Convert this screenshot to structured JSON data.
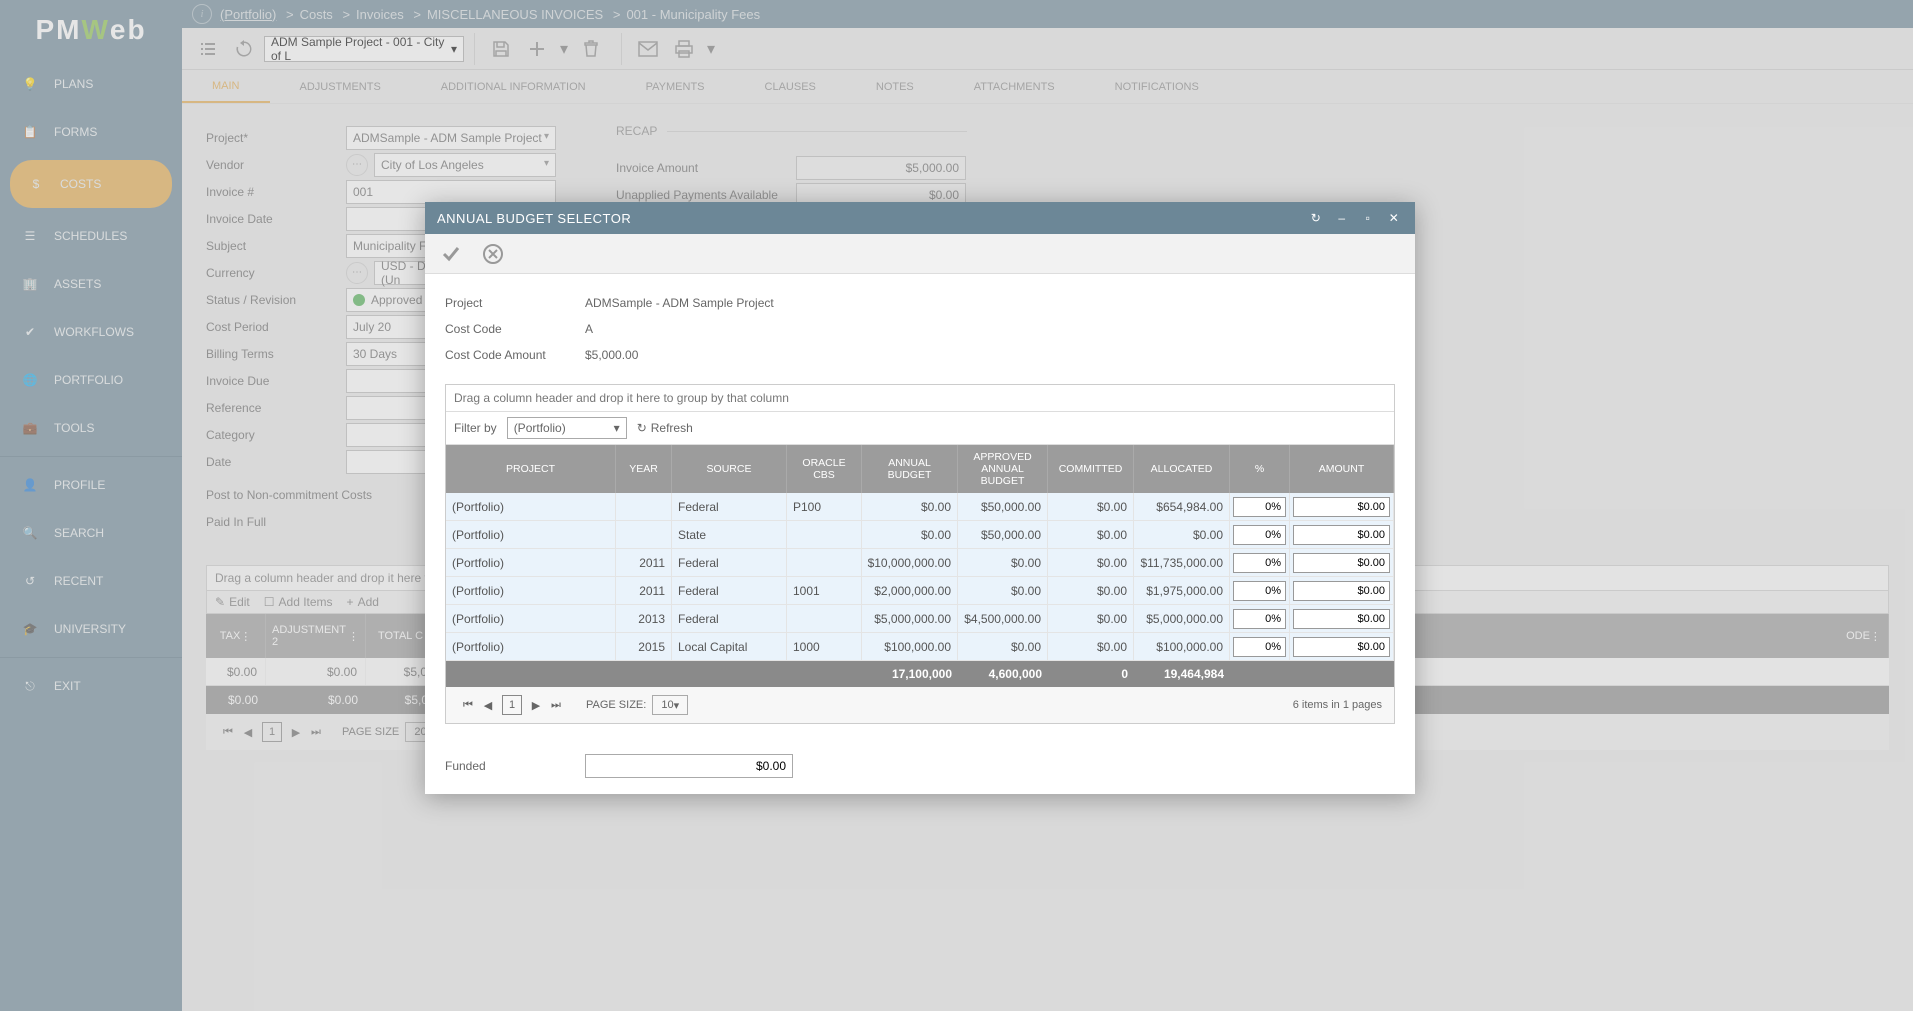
{
  "logo": {
    "p": "PM",
    "w": "W",
    "eb": "eb"
  },
  "breadcrumb": {
    "portfolio": "(Portfolio)",
    "c1": "Costs",
    "c2": "Invoices",
    "c3": "MISCELLANEOUS INVOICES",
    "c4": "001 - Municipality Fees"
  },
  "sidebar": {
    "plans": "PLANS",
    "forms": "FORMS",
    "costs": "COSTS",
    "schedules": "SCHEDULES",
    "assets": "ASSETS",
    "workflows": "WORKFLOWS",
    "portfolio": "PORTFOLIO",
    "tools": "TOOLS",
    "profile": "PROFILE",
    "search": "SEARCH",
    "recent": "RECENT",
    "university": "UNIVERSITY",
    "exit": "EXIT"
  },
  "toolbar": {
    "project": "ADM Sample Project - 001 - City of L"
  },
  "tabs": {
    "main": "MAIN",
    "adjustments": "ADJUSTMENTS",
    "additional": "ADDITIONAL INFORMATION",
    "payments": "PAYMENTS",
    "clauses": "CLAUSES",
    "notes": "NOTES",
    "attachments": "ATTACHMENTS",
    "notifications": "NOTIFICATIONS"
  },
  "form": {
    "labels": {
      "project": "Project*",
      "vendor": "Vendor",
      "invoice_no": "Invoice #",
      "invoice_date": "Invoice Date",
      "subject": "Subject",
      "currency": "Currency",
      "status": "Status / Revision",
      "cost_period": "Cost Period",
      "billing_terms": "Billing Terms",
      "invoice_due": "Invoice Due",
      "reference": "Reference",
      "category": "Category",
      "date": "Date",
      "post_noncommit": "Post to Non-commitment Costs",
      "paid_full": "Paid In Full"
    },
    "values": {
      "project": "ADMSample - ADM Sample Project",
      "vendor": "City of Los Angeles",
      "invoice_no": "001",
      "subject": "Municipality Fee",
      "currency": "USD - Dollar (Un",
      "status": "Approved",
      "cost_period": "July 20",
      "billing_terms": "30 Days"
    },
    "recap": {
      "title": "RECAP",
      "invoice_amount_lbl": "Invoice Amount",
      "invoice_amount": "$5,000.00",
      "unapplied_lbl": "Unapplied Payments Available",
      "unapplied": "$0.00"
    }
  },
  "bottom_grid": {
    "group_hint": "Drag a column header and drop it here to g",
    "edit": "Edit",
    "add_items": "Add Items",
    "add": "Add",
    "headers": {
      "tax": "TAX",
      "adj2": "ADJUSTMENT 2",
      "totalc": "TOTAL C",
      "ode": "ODE"
    },
    "row": {
      "v1": "$0.00",
      "v2": "$0.00",
      "v3": "$5,0"
    },
    "totals": {
      "v1": "$0.00",
      "v2": "$0.00",
      "v3": "$5,0"
    },
    "page_size_lbl": "PAGE SIZE",
    "page_size": "20",
    "page": "1"
  },
  "modal": {
    "title": "ANNUAL BUDGET SELECTOR",
    "info": {
      "project_lbl": "Project",
      "project": "ADMSample - ADM Sample Project",
      "costcode_lbl": "Cost Code",
      "costcode": "A",
      "amount_lbl": "Cost Code Amount",
      "amount": "$5,000.00"
    },
    "grid": {
      "group_hint": "Drag a column header and drop it here to group by that column",
      "filter_by": "Filter by",
      "filter_value": "(Portfolio)",
      "refresh": "Refresh",
      "headers": {
        "project": "PROJECT",
        "year": "YEAR",
        "source": "SOURCE",
        "oracle": "ORACLE CBS",
        "annual": "ANNUAL BUDGET",
        "approved": "APPROVED ANNUAL BUDGET",
        "committed": "COMMITTED",
        "allocated": "ALLOCATED",
        "pct": "%",
        "amount": "AMOUNT"
      },
      "rows": [
        {
          "project": "(Portfolio)",
          "year": "",
          "source": "Federal",
          "oracle": "P100",
          "annual": "$0.00",
          "approved": "$50,000.00",
          "committed": "$0.00",
          "allocated": "$654,984.00",
          "pct": "0%",
          "amount": "$0.00"
        },
        {
          "project": "(Portfolio)",
          "year": "",
          "source": "State",
          "oracle": "",
          "annual": "$0.00",
          "approved": "$50,000.00",
          "committed": "$0.00",
          "allocated": "$0.00",
          "pct": "0%",
          "amount": "$0.00"
        },
        {
          "project": "(Portfolio)",
          "year": "2011",
          "source": "Federal",
          "oracle": "",
          "annual": "$10,000,000.00",
          "approved": "$0.00",
          "committed": "$0.00",
          "allocated": "$11,735,000.00",
          "pct": "0%",
          "amount": "$0.00"
        },
        {
          "project": "(Portfolio)",
          "year": "2011",
          "source": "Federal",
          "oracle": "1001",
          "annual": "$2,000,000.00",
          "approved": "$0.00",
          "committed": "$0.00",
          "allocated": "$1,975,000.00",
          "pct": "0%",
          "amount": "$0.00"
        },
        {
          "project": "(Portfolio)",
          "year": "2013",
          "source": "Federal",
          "oracle": "",
          "annual": "$5,000,000.00",
          "approved": "$4,500,000.00",
          "committed": "$0.00",
          "allocated": "$5,000,000.00",
          "pct": "0%",
          "amount": "$0.00"
        },
        {
          "project": "(Portfolio)",
          "year": "2015",
          "source": "Local Capital",
          "oracle": "1000",
          "annual": "$100,000.00",
          "approved": "$0.00",
          "committed": "$0.00",
          "allocated": "$100,000.00",
          "pct": "0%",
          "amount": "$0.00"
        }
      ],
      "totals": {
        "annual": "17,100,000",
        "approved": "4,600,000",
        "committed": "0",
        "allocated": "19,464,984"
      },
      "page_size_lbl": "PAGE SIZE:",
      "page_size": "10",
      "page": "1",
      "pager_info": "6 items in 1 pages"
    },
    "funded_lbl": "Funded",
    "funded": "$0.00"
  }
}
